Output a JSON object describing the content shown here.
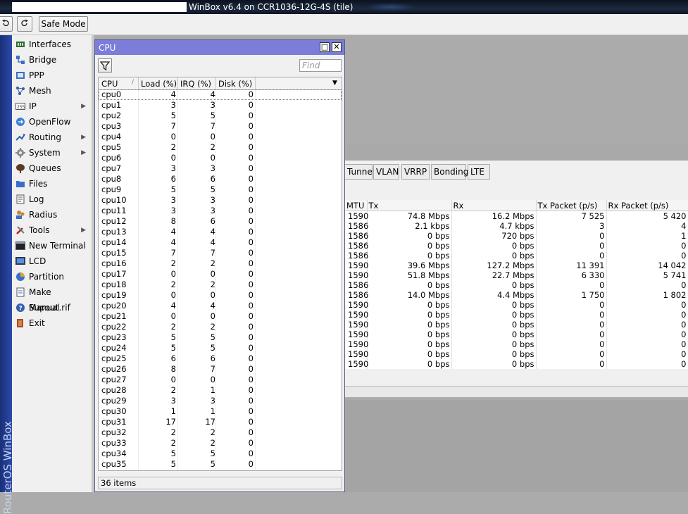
{
  "window": {
    "title": "WinBox v6.4 on CCR1036-12G-4S (tile)"
  },
  "toolbar": {
    "undo_icon": "undo-icon",
    "redo_icon": "redo-icon",
    "safe_mode_label": "Safe Mode"
  },
  "brand": {
    "vertical_text": "RouterOS WinBox"
  },
  "menu": {
    "items": [
      {
        "label": "Interfaces",
        "icon": "interfaces-icon"
      },
      {
        "label": "Bridge",
        "icon": "bridge-icon"
      },
      {
        "label": "PPP",
        "icon": "ppp-icon"
      },
      {
        "label": "Mesh",
        "icon": "mesh-icon"
      },
      {
        "label": "IP",
        "icon": "ip-icon",
        "submenu": true
      },
      {
        "label": "OpenFlow",
        "icon": "openflow-icon"
      },
      {
        "label": "Routing",
        "icon": "routing-icon",
        "submenu": true
      },
      {
        "label": "System",
        "icon": "system-icon",
        "submenu": true
      },
      {
        "label": "Queues",
        "icon": "queues-icon"
      },
      {
        "label": "Files",
        "icon": "files-icon"
      },
      {
        "label": "Log",
        "icon": "log-icon"
      },
      {
        "label": "Radius",
        "icon": "radius-icon"
      },
      {
        "label": "Tools",
        "icon": "tools-icon",
        "submenu": true
      },
      {
        "label": "New Terminal",
        "icon": "terminal-icon"
      },
      {
        "label": "LCD",
        "icon": "lcd-icon"
      },
      {
        "label": "Partition",
        "icon": "partition-icon"
      },
      {
        "label": "Make Supout.rif",
        "icon": "supout-icon"
      },
      {
        "label": "Manual",
        "icon": "manual-icon"
      },
      {
        "label": "Exit",
        "icon": "exit-icon"
      }
    ],
    "submenu_arrow": "▶"
  },
  "cpu_window": {
    "title": "CPU",
    "restore_glyph": "□",
    "close_glyph": "✕",
    "find_placeholder": "Find",
    "columns": [
      "CPU",
      "Load (%)",
      "IRQ (%)",
      "Disk (%)"
    ],
    "sort_indicator": "/",
    "dropdown_glyph": "▼",
    "rows": [
      [
        "cpu0",
        "4",
        "4",
        "0"
      ],
      [
        "cpu1",
        "3",
        "3",
        "0"
      ],
      [
        "cpu2",
        "5",
        "5",
        "0"
      ],
      [
        "cpu3",
        "7",
        "7",
        "0"
      ],
      [
        "cpu4",
        "0",
        "0",
        "0"
      ],
      [
        "cpu5",
        "2",
        "2",
        "0"
      ],
      [
        "cpu6",
        "0",
        "0",
        "0"
      ],
      [
        "cpu7",
        "3",
        "3",
        "0"
      ],
      [
        "cpu8",
        "6",
        "6",
        "0"
      ],
      [
        "cpu9",
        "5",
        "5",
        "0"
      ],
      [
        "cpu10",
        "3",
        "3",
        "0"
      ],
      [
        "cpu11",
        "3",
        "3",
        "0"
      ],
      [
        "cpu12",
        "8",
        "6",
        "0"
      ],
      [
        "cpu13",
        "4",
        "4",
        "0"
      ],
      [
        "cpu14",
        "4",
        "4",
        "0"
      ],
      [
        "cpu15",
        "7",
        "7",
        "0"
      ],
      [
        "cpu16",
        "2",
        "2",
        "0"
      ],
      [
        "cpu17",
        "0",
        "0",
        "0"
      ],
      [
        "cpu18",
        "2",
        "2",
        "0"
      ],
      [
        "cpu19",
        "0",
        "0",
        "0"
      ],
      [
        "cpu20",
        "4",
        "4",
        "0"
      ],
      [
        "cpu21",
        "0",
        "0",
        "0"
      ],
      [
        "cpu22",
        "2",
        "2",
        "0"
      ],
      [
        "cpu23",
        "5",
        "5",
        "0"
      ],
      [
        "cpu24",
        "5",
        "5",
        "0"
      ],
      [
        "cpu25",
        "6",
        "6",
        "0"
      ],
      [
        "cpu26",
        "8",
        "7",
        "0"
      ],
      [
        "cpu27",
        "0",
        "0",
        "0"
      ],
      [
        "cpu28",
        "2",
        "1",
        "0"
      ],
      [
        "cpu29",
        "3",
        "3",
        "0"
      ],
      [
        "cpu30",
        "1",
        "1",
        "0"
      ],
      [
        "cpu31",
        "17",
        "17",
        "0"
      ],
      [
        "cpu32",
        "2",
        "2",
        "0"
      ],
      [
        "cpu33",
        "2",
        "2",
        "0"
      ],
      [
        "cpu34",
        "5",
        "5",
        "0"
      ],
      [
        "cpu35",
        "5",
        "5",
        "0"
      ]
    ],
    "status": "36 items"
  },
  "interface_window": {
    "tabs": [
      "Tunnel",
      "VLAN",
      "VRRP",
      "Bonding",
      "LTE"
    ],
    "columns": [
      "MTU",
      "Tx",
      "Rx",
      "Tx Packet (p/s)",
      "Rx Packet (p/s)"
    ],
    "rows": [
      [
        "1590",
        "74.8 Mbps",
        "16.2 Mbps",
        "7 525",
        "5 420"
      ],
      [
        "1586",
        "2.1 kbps",
        "4.7 kbps",
        "3",
        "4"
      ],
      [
        "1586",
        "0 bps",
        "720 bps",
        "0",
        "1"
      ],
      [
        "1586",
        "0 bps",
        "0 bps",
        "0",
        "0"
      ],
      [
        "1586",
        "0 bps",
        "0 bps",
        "0",
        "0"
      ],
      [
        "1590",
        "39.6 Mbps",
        "127.2 Mbps",
        "11 391",
        "14 042"
      ],
      [
        "1590",
        "51.8 Mbps",
        "22.7 Mbps",
        "6 330",
        "5 741"
      ],
      [
        "1586",
        "0 bps",
        "0 bps",
        "0",
        "0"
      ],
      [
        "1586",
        "14.0 Mbps",
        "4.4 Mbps",
        "1 750",
        "1 802"
      ],
      [
        "1590",
        "0 bps",
        "0 bps",
        "0",
        "0"
      ],
      [
        "1590",
        "0 bps",
        "0 bps",
        "0",
        "0"
      ],
      [
        "1590",
        "0 bps",
        "0 bps",
        "0",
        "0"
      ],
      [
        "1590",
        "0 bps",
        "0 bps",
        "0",
        "0"
      ],
      [
        "1590",
        "0 bps",
        "0 bps",
        "0",
        "0"
      ],
      [
        "1590",
        "0 bps",
        "0 bps",
        "0",
        "0"
      ],
      [
        "1590",
        "0 bps",
        "0 bps",
        "0",
        "0"
      ]
    ]
  }
}
